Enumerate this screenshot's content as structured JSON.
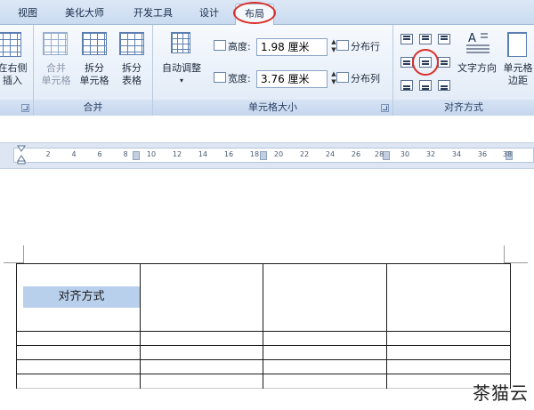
{
  "tabs": [
    "视图",
    "美化大师",
    "开发工具",
    "设计",
    "布局"
  ],
  "active_tab": "布局",
  "ribbon": {
    "group_rowcol": {
      "buttons": [
        {
          "label1": "在右侧",
          "label2": "插入"
        }
      ],
      "launcher_icon": "dialog-launcher-icon"
    },
    "group_merge": {
      "title": "合并",
      "buttons": [
        {
          "label1": "合并",
          "label2": "单元格"
        },
        {
          "label1": "拆分",
          "label2": "单元格"
        },
        {
          "label1": "拆分",
          "label2": "表格"
        }
      ]
    },
    "group_cellsize": {
      "title": "单元格大小",
      "autofit_label": "自动调整",
      "height_label": "高度:",
      "height_value": "1.98 厘米",
      "width_label": "宽度:",
      "width_value": "3.76 厘米",
      "distribute_rows": "分布行",
      "distribute_cols": "分布列"
    },
    "group_align": {
      "title": "对齐方式",
      "text_direction": "文字方向",
      "cell_margin1": "单元格",
      "cell_margin2": "边距"
    }
  },
  "ruler": {
    "numbers": [
      "2",
      "4",
      "6",
      "8",
      "10",
      "12",
      "14",
      "16",
      "18",
      "20",
      "22",
      "24",
      "26",
      "28",
      "30",
      "32",
      "34",
      "36",
      "38"
    ]
  },
  "document": {
    "cell_text": "对齐方式"
  },
  "watermark": "茶猫云",
  "colors": {
    "highlight_ring": "#d9302a",
    "cell_fill": "#b9d0ec",
    "ribbon_bg": "#dfe9f6"
  }
}
